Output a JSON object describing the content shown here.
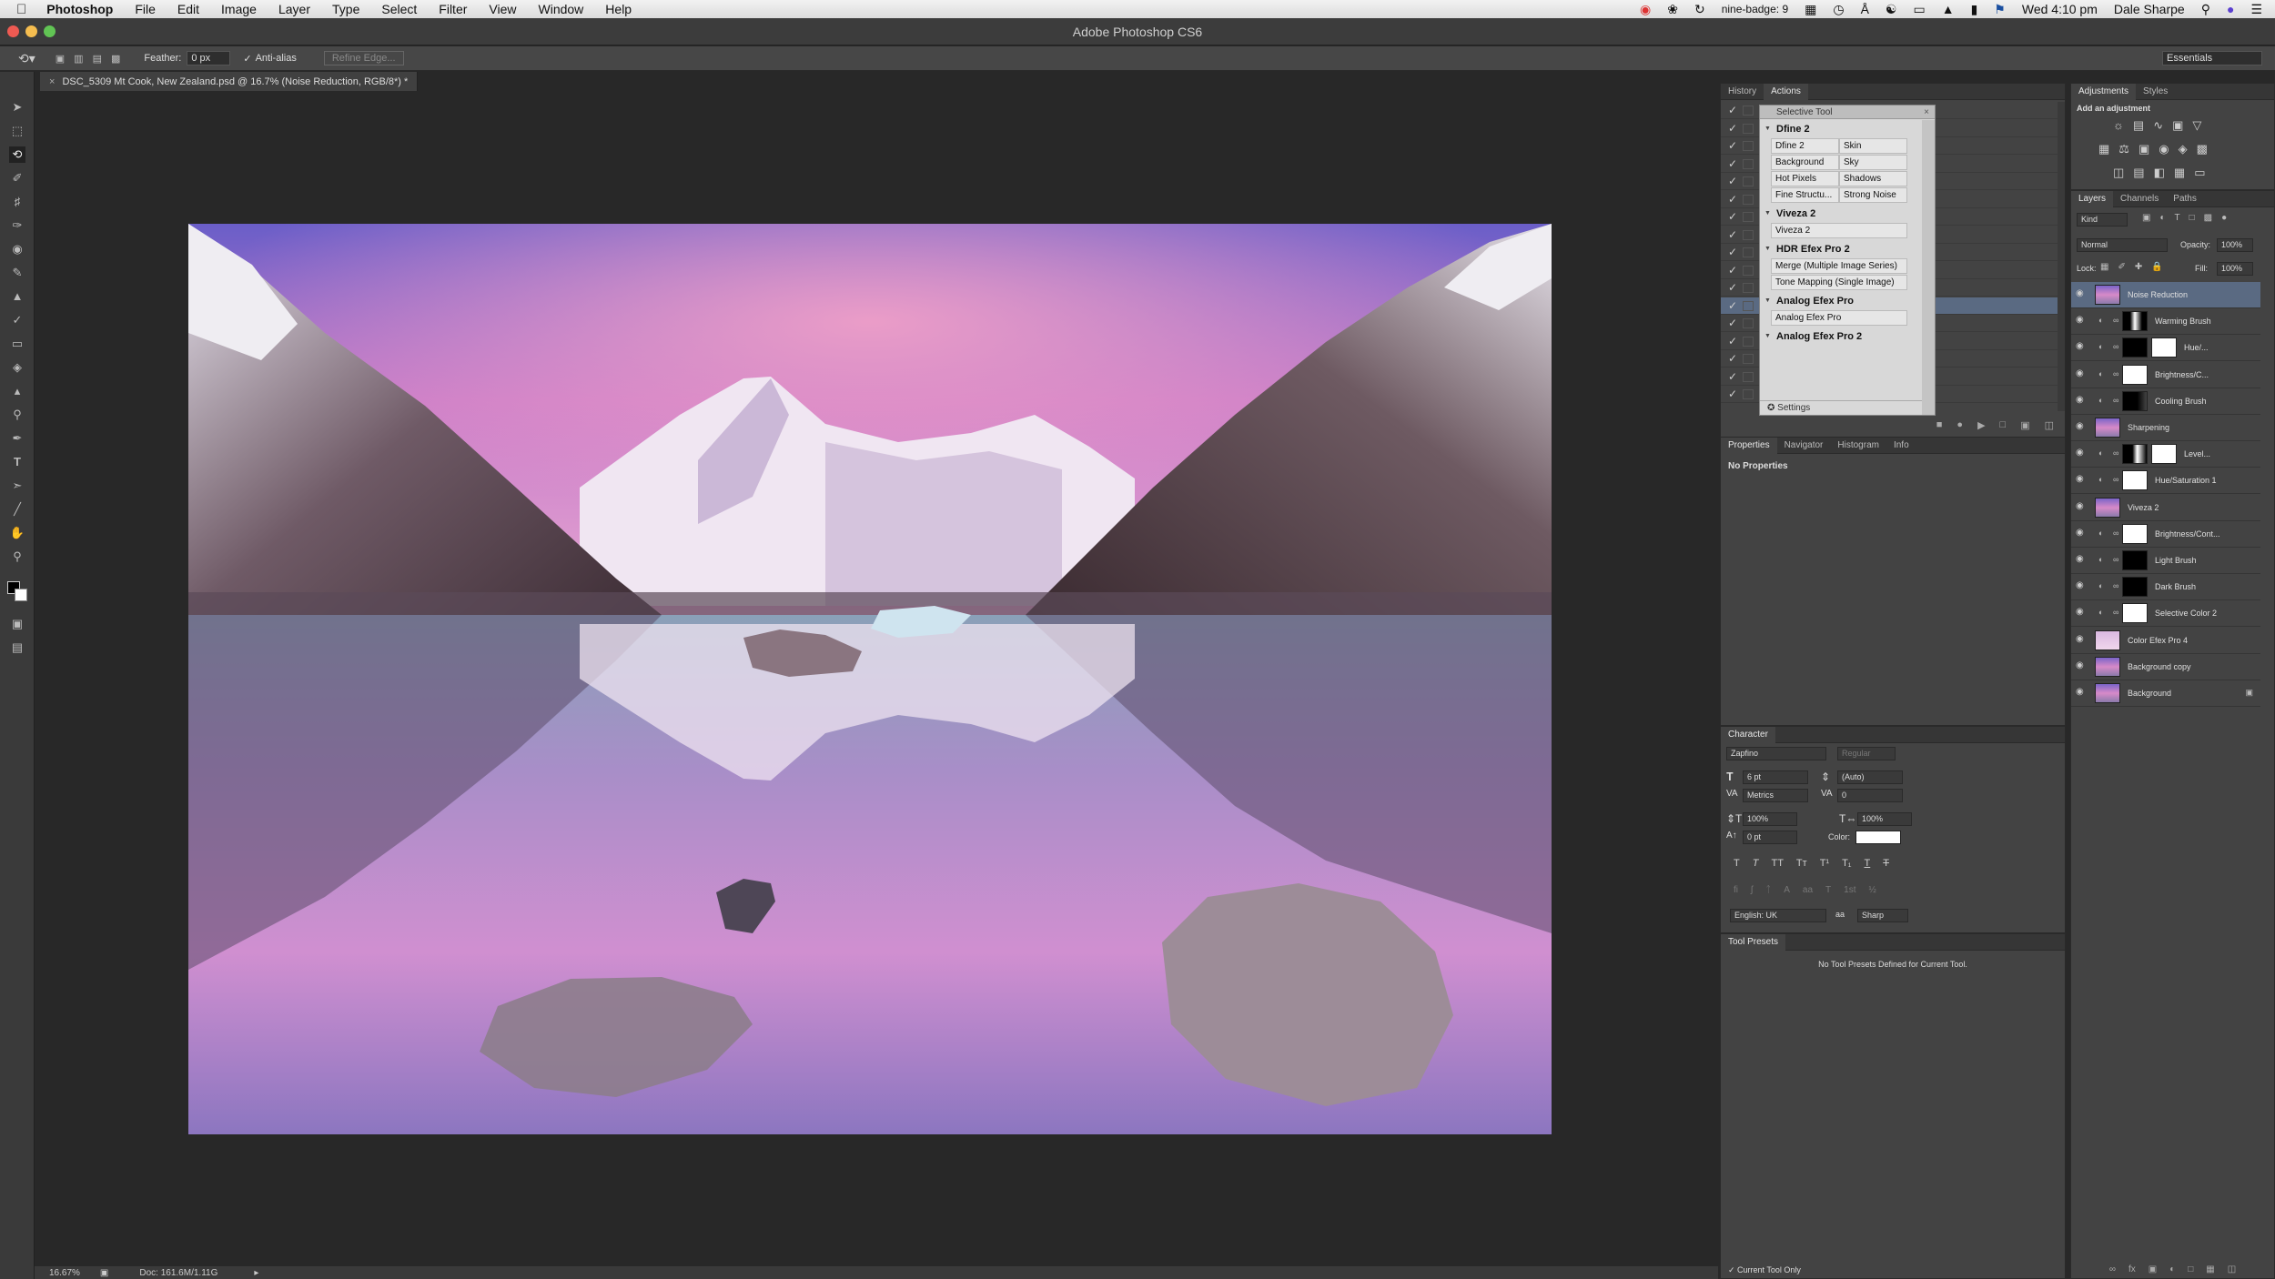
{
  "menubar": {
    "app": "Photoshop",
    "items": [
      "File",
      "Edit",
      "Image",
      "Layer",
      "Type",
      "Select",
      "Filter",
      "View",
      "Window",
      "Help"
    ],
    "clock": "Wed 4:10 pm",
    "user": "Dale Sharpe",
    "status_icons": [
      "nine-badge: 9"
    ]
  },
  "window": {
    "title": "Adobe Photoshop CS6"
  },
  "options": {
    "feather_label": "Feather:",
    "feather_value": "0 px",
    "antialias_label": "Anti-alias",
    "refine_label": "Refine Edge...",
    "workspace": "Essentials"
  },
  "document": {
    "tab_label": "DSC_5309 Mt Cook, New Zealand.psd @ 16.7% (Noise Reduction, RGB/8*) *",
    "zoom": "16.67%",
    "doc_size": "Doc: 161.6M/1.11G"
  },
  "history_actions": {
    "tabs": [
      "History",
      "Actions"
    ],
    "active": "Actions"
  },
  "selective_tool": {
    "title": "Selective Tool",
    "groups": [
      {
        "name": "Dfine 2",
        "pairs": [
          [
            "Dfine 2",
            "Skin"
          ],
          [
            "Background",
            "Sky"
          ],
          [
            "Hot Pixels",
            "Shadows"
          ],
          [
            "Fine Structu...",
            "Strong Noise"
          ]
        ]
      },
      {
        "name": "Viveza 2",
        "items": [
          "Viveza 2"
        ]
      },
      {
        "name": "HDR Efex Pro 2",
        "items": [
          "Merge (Multiple Image Series)",
          "Tone Mapping (Single Image)"
        ]
      },
      {
        "name": "Analog Efex Pro",
        "items": [
          "Analog Efex Pro"
        ]
      },
      {
        "name": "Analog Efex Pro 2",
        "items": []
      }
    ],
    "settings": "Settings"
  },
  "properties": {
    "tabs": [
      "Properties",
      "Navigator",
      "Histogram",
      "Info"
    ],
    "empty": "No Properties"
  },
  "character": {
    "title": "Character",
    "font": "Zapfino",
    "style": "Regular",
    "size": "6 pt",
    "leading": "(Auto)",
    "kerning": "Metrics",
    "tracking": "0",
    "vscale": "100%",
    "hscale": "100%",
    "baseline": "0 pt",
    "color_label": "Color:",
    "language": "English: UK",
    "aa_glyph": "aa",
    "antialias": "Sharp",
    "style_buttons": [
      "T",
      "T",
      "TT",
      "Tт",
      "T¹",
      "T₁",
      "T",
      "T"
    ]
  },
  "tool_presets": {
    "title": "Tool Presets",
    "empty": "No Tool Presets Defined for Current Tool.",
    "current_only": "Current Tool Only"
  },
  "adjustments": {
    "tabs": [
      "Adjustments",
      "Styles"
    ],
    "heading": "Add an adjustment"
  },
  "layers": {
    "tabs": [
      "Layers",
      "Channels",
      "Paths"
    ],
    "kind": "Kind",
    "blend": "Normal",
    "opacity_label": "Opacity:",
    "opacity": "100%",
    "lock_label": "Lock:",
    "fill_label": "Fill:",
    "fill": "100%",
    "items": [
      {
        "name": "Noise Reduction",
        "type": "photo",
        "selected": true
      },
      {
        "name": "Warming Brush",
        "type": "mask-mixed"
      },
      {
        "name": "Hue/...",
        "type": "adj-black-white"
      },
      {
        "name": "Brightness/C...",
        "type": "adj-white"
      },
      {
        "name": "Cooling Brush",
        "type": "mask-dark"
      },
      {
        "name": "Sharpening",
        "type": "photo"
      },
      {
        "name": "Level...",
        "type": "adj-mixed-white"
      },
      {
        "name": "Hue/Saturation 1",
        "type": "adj-white"
      },
      {
        "name": "Viveza 2",
        "type": "photo"
      },
      {
        "name": "Brightness/Cont...",
        "type": "adj-white"
      },
      {
        "name": "Light Brush",
        "type": "adj-black"
      },
      {
        "name": "Dark Brush",
        "type": "adj-black"
      },
      {
        "name": "Selective Color 2",
        "type": "adj-white"
      },
      {
        "name": "Color Efex Pro 4",
        "type": "photo-light"
      },
      {
        "name": "Background copy",
        "type": "photo"
      },
      {
        "name": "Background",
        "type": "photo",
        "locked": true
      }
    ]
  }
}
